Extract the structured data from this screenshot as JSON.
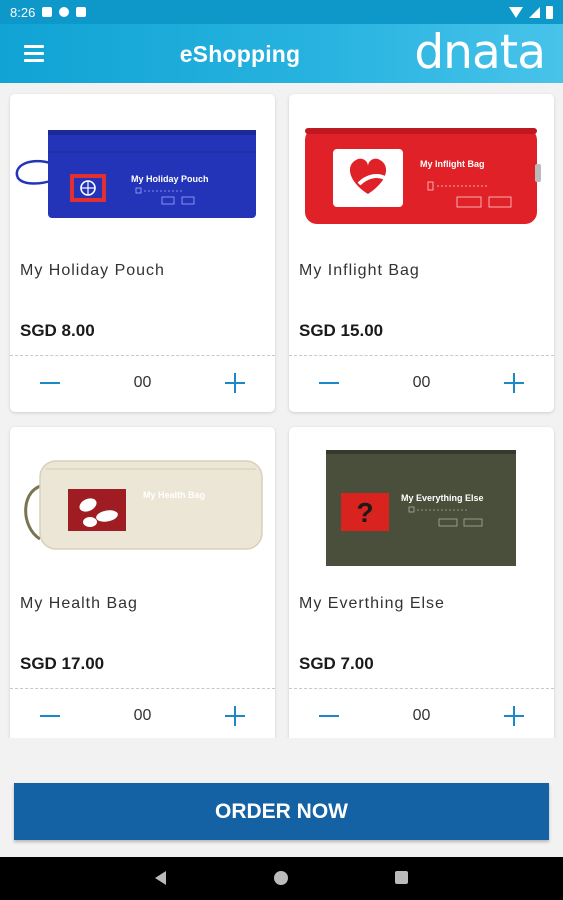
{
  "status_bar": {
    "time": "8:26",
    "left_icons": [
      "notification-icon",
      "notification-icon",
      "app-icon",
      "sd-card-icon"
    ],
    "right_icons": [
      "wifi-icon",
      "signal-icon",
      "battery-icon"
    ]
  },
  "app_bar": {
    "title": "eShopping",
    "brand": "dnata",
    "menu_icon": "menu-icon"
  },
  "products": [
    {
      "name": "My Holiday Pouch",
      "price": "SGD 8.00",
      "quantity": "00",
      "image_label": "My Holiday Pouch",
      "bag_color": "#2434b8",
      "icon": "airplane-icon"
    },
    {
      "name": "My Inflight Bag",
      "price": "SGD 15.00",
      "quantity": "00",
      "image_label": "My Inflight Bag",
      "bag_color": "#e02128",
      "icon": "heart-icon"
    },
    {
      "name": "My Health Bag",
      "price": "SGD 17.00",
      "quantity": "00",
      "image_label": "My Health Bag",
      "bag_color": "#ece6d6",
      "icon": "pills-icon"
    },
    {
      "name": "My Everthing Else",
      "price": "SGD 7.00",
      "quantity": "00",
      "image_label": "My Everything Else",
      "bag_color": "#4a4f3b",
      "icon": "question-icon"
    }
  ],
  "order_button": {
    "label": "ORDER NOW",
    "color": "#1462a3"
  },
  "accent_color": "#1a89c6",
  "nav_bar": {
    "icons": [
      "back-icon",
      "home-icon",
      "recents-icon"
    ]
  }
}
